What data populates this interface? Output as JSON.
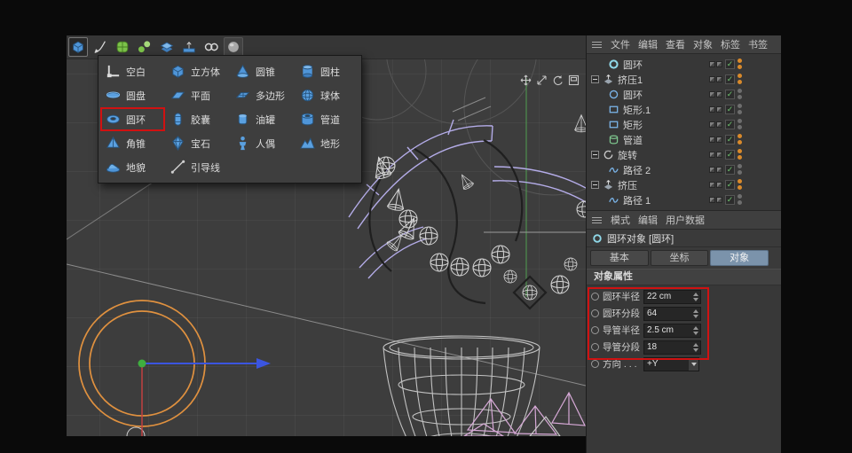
{
  "toolbar": {
    "tools": [
      {
        "icon": "cube-primitive-tool",
        "active": true
      },
      {
        "icon": "spline-pen-tool",
        "active": false
      },
      {
        "icon": "subdivision-surface-tool",
        "active": false
      },
      {
        "icon": "array-generator-tool",
        "active": false
      },
      {
        "icon": "extrude-generator-tool",
        "active": false
      },
      {
        "icon": "floor-environment-tool",
        "active": false
      },
      {
        "icon": "null-rings-tool",
        "active": false
      },
      {
        "icon": "material-sphere-tool",
        "active": false
      }
    ]
  },
  "primitives_menu": {
    "items": [
      {
        "label": "空白",
        "icon": "null-axis"
      },
      {
        "label": "立方体",
        "icon": "cube"
      },
      {
        "label": "圆锥",
        "icon": "cone"
      },
      {
        "label": "圆柱",
        "icon": "cylinder"
      },
      {
        "label": "圆盘",
        "icon": "disc"
      },
      {
        "label": "平面",
        "icon": "plane"
      },
      {
        "label": "多边形",
        "icon": "polygon"
      },
      {
        "label": "球体",
        "icon": "sphere"
      },
      {
        "label": "圆环",
        "icon": "torus",
        "highlighted": true
      },
      {
        "label": "胶囊",
        "icon": "capsule"
      },
      {
        "label": "油罐",
        "icon": "oil-tank"
      },
      {
        "label": "管道",
        "icon": "tube"
      },
      {
        "label": "角锥",
        "icon": "pyramid"
      },
      {
        "label": "宝石",
        "icon": "gem"
      },
      {
        "label": "人偶",
        "icon": "figure"
      },
      {
        "label": "地形",
        "icon": "terrain"
      },
      {
        "label": "地貌",
        "icon": "landscape"
      },
      {
        "label": "引导线",
        "icon": "guide-line"
      }
    ]
  },
  "viewport_nav": {
    "icons": [
      "pan",
      "zoom",
      "rotate",
      "maximize"
    ]
  },
  "object_manager": {
    "menu": [
      "文件",
      "编辑",
      "查看",
      "对象",
      "标签",
      "书签"
    ],
    "items": [
      {
        "label": "圆环",
        "depth": 1,
        "expander": false,
        "icon": "torus-object",
        "dots": "orange"
      },
      {
        "label": "挤压1",
        "depth": 0,
        "expander": true,
        "icon": "extrude-object",
        "dots": "orange"
      },
      {
        "label": "圆环",
        "depth": 1,
        "expander": false,
        "icon": "circle-spline",
        "dots": "gray"
      },
      {
        "label": "矩形.1",
        "depth": 1,
        "expander": false,
        "icon": "rectangle-spline",
        "dots": "gray"
      },
      {
        "label": "矩形",
        "depth": 1,
        "expander": false,
        "icon": "rectangle-spline",
        "dots": "gray"
      },
      {
        "label": "管道",
        "depth": 1,
        "expander": false,
        "icon": "tube-object",
        "dots": "orange"
      },
      {
        "label": "旋转",
        "depth": 0,
        "expander": true,
        "icon": "lathe-object",
        "dots": "orange"
      },
      {
        "label": "路径 2",
        "depth": 1,
        "expander": false,
        "icon": "path-spline",
        "dots": "gray"
      },
      {
        "label": "挤压",
        "depth": 0,
        "expander": true,
        "icon": "extrude-object",
        "dots": "orange"
      },
      {
        "label": "路径 1",
        "depth": 1,
        "expander": false,
        "icon": "path-spline",
        "dots": "gray"
      }
    ]
  },
  "attribute_manager": {
    "menu": [
      "模式",
      "编辑",
      "用户数据"
    ],
    "title": "圆环对象 [圆环]",
    "tabs": [
      {
        "label": "基本",
        "active": false
      },
      {
        "label": "坐标",
        "active": false
      },
      {
        "label": "对象",
        "active": true
      }
    ],
    "section": "对象属性",
    "properties": [
      {
        "label": "圆环半径",
        "value": "22 cm",
        "type": "number"
      },
      {
        "label": "圆环分段",
        "value": "64",
        "type": "number"
      },
      {
        "label": "导管半径",
        "value": "2.5 cm",
        "type": "number"
      },
      {
        "label": "导管分段",
        "value": "18",
        "type": "number"
      },
      {
        "label": "方向 . . .",
        "value": "+Y",
        "type": "dropdown"
      }
    ]
  },
  "colors": {
    "highlight_red": "#cf1212",
    "torus_orange": "#e0913f",
    "selected_tab_blue": "#7b93ab",
    "enabled_check_green": "#6fc66f",
    "visibility_dot_orange": "#d98a2b"
  }
}
